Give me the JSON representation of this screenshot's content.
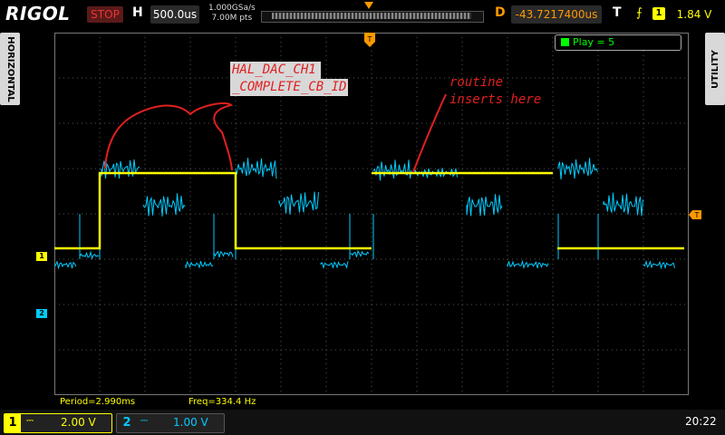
{
  "top": {
    "brand": "RIGOL",
    "run_state": "STOP",
    "horizontal_label": "H",
    "timebase": "500.0us",
    "sample_rate": "1.000GSa/s",
    "mem_depth": "7.00M pts",
    "delay_label": "D",
    "delay_value": "-43.7217400us",
    "trigger_label": "T",
    "trigger_icon": "rising-edge-icon",
    "trigger_source": "1",
    "trigger_level": "1.84 V"
  },
  "side": {
    "left_tab": "HORIZONTAL",
    "right_tab": "UTILITY"
  },
  "screen": {
    "play_label": "Play = 5",
    "annotation1_line1": "HAL_DAC_CH1",
    "annotation1_line2": "_COMPLETE_CB_ID",
    "annotation2_line1": "routine",
    "annotation2_line2": "inserts here",
    "period": "Period=2.990ms",
    "freq": "Freq=334.4 Hz",
    "ch1_marker": "1",
    "ch2_marker": "2"
  },
  "bottom": {
    "ch1_number": "1",
    "ch1_coupling_icon": "dc-coupling-icon",
    "ch1_scale": "2.00 V",
    "ch2_number": "2",
    "ch2_coupling_icon": "dc-coupling-icon",
    "ch2_scale": "1.00 V",
    "clock": "20:22"
  },
  "colors": {
    "ch1": "#ffff00",
    "ch2": "#00ccff",
    "annotation": "#e02020",
    "trigger": "#ff9900"
  }
}
